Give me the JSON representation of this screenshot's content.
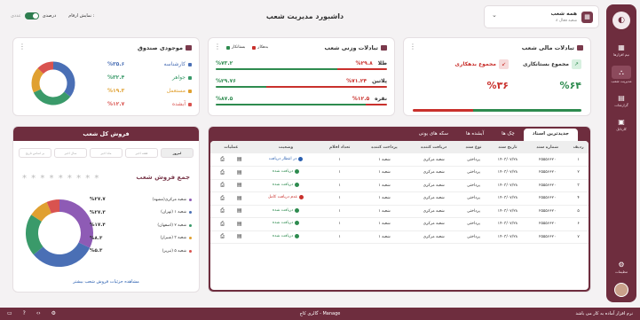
{
  "page_title": "داشبورد مدیریت شعب",
  "branch_selector": {
    "title": "همه شعب",
    "subtitle": "۸ شعبه فعال"
  },
  "toggle": {
    "label": "نمایش ارقام :",
    "state": "درصدی",
    "alt": "عددی"
  },
  "sidebar": {
    "items": [
      {
        "label": "نیم افزارها",
        "icon": "grid-icon"
      },
      {
        "label": "مدیریت شعب",
        "icon": "network-icon",
        "active": true
      },
      {
        "label": "گزارشات",
        "icon": "chart-icon"
      },
      {
        "label": "کارتابل",
        "icon": "inbox-icon"
      }
    ],
    "settings_label": "تنظیمات"
  },
  "fund": {
    "title": "موجودی صندوق",
    "rows": [
      {
        "label": "کارشناسه",
        "value": "%۳۵.۶",
        "color": "#4a6fb5"
      },
      {
        "label": "جواهر",
        "value": "%۳۲.۴",
        "color": "#3a9a6a"
      },
      {
        "label": "مستعمل",
        "value": "%۱۹.۳",
        "color": "#e0a030"
      },
      {
        "label": "آبشده",
        "value": "%۱۲.۷",
        "color": "#d9534f"
      }
    ]
  },
  "gold": {
    "title": "تبادلات وزنی شعب",
    "legend": {
      "debtor": "بدهکار",
      "creditor": "بستانکار"
    },
    "rows": [
      {
        "label": "طلا",
        "debtor": "%۲۹.۸",
        "creditor": "%۷۳.۲",
        "d": 29.8,
        "c": 73.2
      },
      {
        "label": "پلاتین",
        "debtor": "%۷۱.۲۴",
        "creditor": "%۲۹.۷۶",
        "d": 71.24,
        "c": 29.76
      },
      {
        "label": "نقره",
        "debtor": "%۱۲.۵",
        "creditor": "%۸۷.۵",
        "d": 12.5,
        "c": 87.5
      }
    ]
  },
  "money": {
    "title": "تبادلات مالی شعب",
    "creditor_label": "مجموع بستانکاری",
    "creditor_value": "%۶۴",
    "debtor_label": "مجموع بدهکاری",
    "debtor_value": "%۳۶",
    "creditor_pct": 64
  },
  "sales": {
    "title": "فروش کل شعب",
    "filters": [
      "امروز",
      "هفته اخیر",
      "ماه اخیر",
      "سال اخیر",
      "بر اساس تاریخ"
    ],
    "total_label": "جمع فروش شعب",
    "total_value": "* * * * * * * * *",
    "rows": [
      {
        "label": "شعبه مرکزی(مشهد)",
        "value": "%۲۷.۷",
        "color": "#8e5bb5",
        "v": 27.7
      },
      {
        "label": "شعبه ۱ (تهران)",
        "value": "%۲۷.۳",
        "color": "#4a6fb5",
        "v": 27.3
      },
      {
        "label": "شعبه ۲ (اصفهان)",
        "value": "%۱۷.۴",
        "color": "#3a9a6a",
        "v": 17.4
      },
      {
        "label": "شعبه ۳ (شیراز)",
        "value": "%۸.۳",
        "color": "#e0a030",
        "v": 8.3
      },
      {
        "label": "شعبه ۵ (تبریز)",
        "value": "%۵.۳",
        "color": "#d9534f",
        "v": 5.3
      }
    ],
    "link": "مشاهده جزئیات فروش شعب بیشتر"
  },
  "docs": {
    "tabs": [
      "جدیدترین اسناد",
      "چک ها",
      "آبشده ها",
      "سکه های یونی"
    ],
    "columns": [
      "ردیف",
      "شماره سند",
      "تاریخ سند",
      "نوع سند",
      "دریافت کننده",
      "پرداخت کننده",
      "تعداد اقلام",
      "وضعیت",
      "عملیات"
    ],
    "rows": [
      {
        "n": "۱",
        "doc": "۲۵۵۵۶۶۲۰",
        "date": "۱۴۰۳/۰۷/۲۸",
        "type": "پرداختی",
        "recv": "شعبه مرکزی",
        "payer": "شعبه ۱",
        "qty": "۱",
        "status": "در انتظار دریافت",
        "sc": "#2a5fb0"
      },
      {
        "n": "۲",
        "doc": "۲۵۵۵۶۶۲۰",
        "date": "۱۴۰۳/۰۷/۲۸",
        "type": "پرداختی",
        "recv": "شعبه مرکزی",
        "payer": "شعبه ۱",
        "qty": "۱",
        "status": "دریافت شده",
        "sc": "#2e8b4f"
      },
      {
        "n": "۳",
        "doc": "۲۵۵۵۶۶۲۰",
        "date": "۱۴۰۳/۰۷/۲۸",
        "type": "پرداختی",
        "recv": "شعبه مرکزی",
        "payer": "شعبه ۱",
        "qty": "۱",
        "status": "دریافت شده",
        "sc": "#2e8b4f"
      },
      {
        "n": "۴",
        "doc": "۲۵۵۵۶۶۲۰",
        "date": "۱۴۰۳/۰۷/۲۸",
        "type": "پرداختی",
        "recv": "شعبه مرکزی",
        "payer": "شعبه ۱",
        "qty": "۱",
        "status": "عدم دریافت کامل",
        "sc": "#c9302c"
      },
      {
        "n": "۵",
        "doc": "۲۵۵۵۶۶۲۰",
        "date": "۱۴۰۳/۰۷/۲۸",
        "type": "پرداختی",
        "recv": "شعبه مرکزی",
        "payer": "شعبه ۱",
        "qty": "۱",
        "status": "دریافت شده",
        "sc": "#2e8b4f"
      },
      {
        "n": "۶",
        "doc": "۲۵۵۵۶۶۲۰",
        "date": "۱۴۰۳/۰۷/۲۸",
        "type": "پرداختی",
        "recv": "شعبه مرکزی",
        "payer": "شعبه ۱",
        "qty": "۱",
        "status": "دریافت شده",
        "sc": "#2e8b4f"
      },
      {
        "n": "۷",
        "doc": "۲۵۵۵۶۶۲۰",
        "date": "۱۴۰۳/۰۷/۲۸",
        "type": "پرداختی",
        "recv": "شعبه مرکزی",
        "payer": "شعبه ۱",
        "qty": "۱",
        "status": "دریافت شده",
        "sc": "#2e8b4f"
      }
    ]
  },
  "bottom": {
    "center": "گالری کاج - Manage",
    "right": "نرم افزار آماده به کار می باشد"
  }
}
